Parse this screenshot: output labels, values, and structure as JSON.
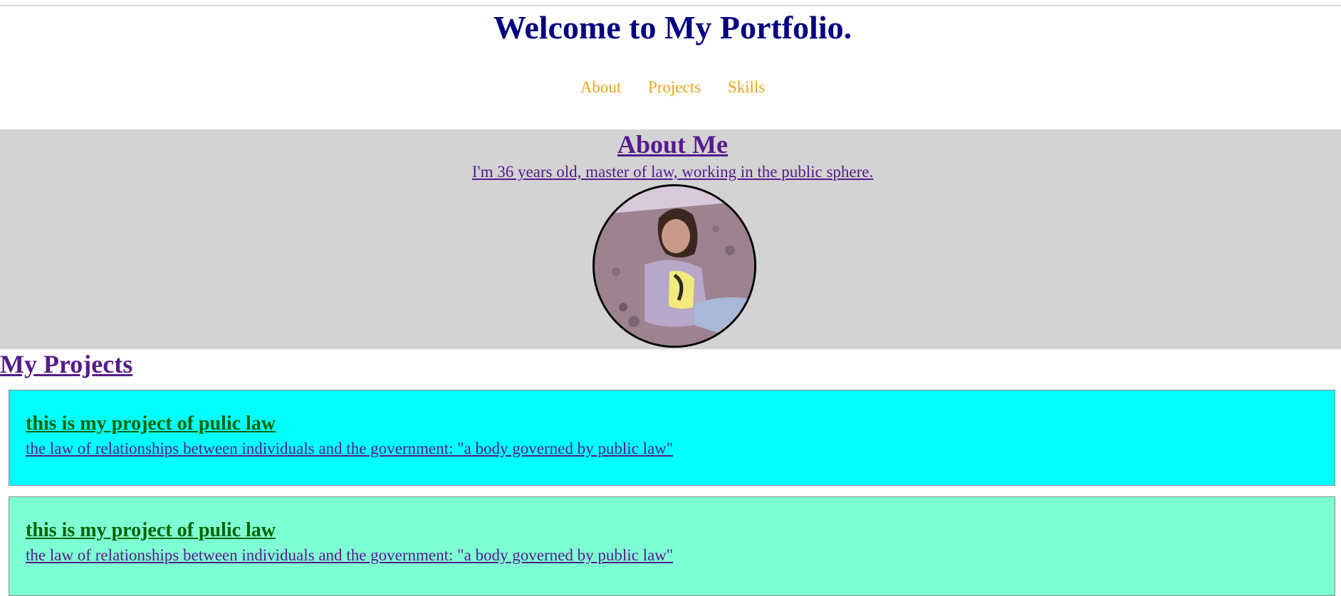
{
  "header": {
    "title": "Welcome to My Portfolio.",
    "nav": [
      "About",
      "Projects",
      "Skills"
    ]
  },
  "about": {
    "title": "About Me",
    "text": "I'm 36 years old, master of law, working in the public sphere."
  },
  "projects": {
    "title": "My Projects",
    "items": [
      {
        "title": "this is my project of pulic law",
        "description": "the law of relationships between individuals and the government: \"a body governed by public law\"",
        "background": "#00ffff"
      },
      {
        "title": "this is my project of pulic law",
        "description": "the law of relationships between individuals and the government: \"a body governed by public law\"",
        "background": "#7fffd4"
      }
    ]
  },
  "colors": {
    "title": "#000080",
    "nav_link": "#e8a317",
    "about_background": "#d3d3d3",
    "link_visited": "#551a8b",
    "project_title": "#006400"
  }
}
